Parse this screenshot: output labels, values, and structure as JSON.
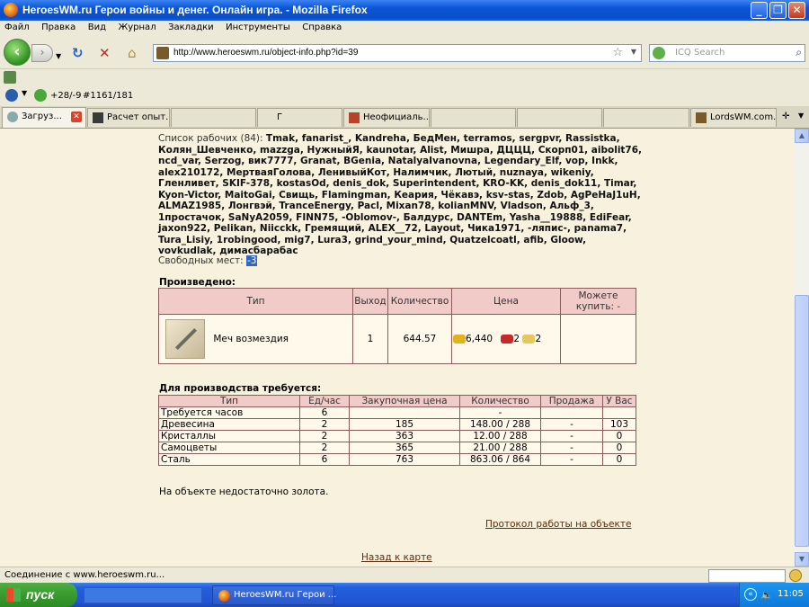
{
  "window": {
    "title": "HeroesWM.ru Герои войны и денег. Онлайн игра. - Mozilla Firefox",
    "minimize": "_",
    "maximize": "❐",
    "close": "✕"
  },
  "menu": [
    "Файл",
    "Правка",
    "Вид",
    "Журнал",
    "Закладки",
    "Инструменты",
    "Справка"
  ],
  "nav": {
    "url": "http://www.heroeswm.ru/object-info.php?id=39",
    "search_placeholder": "ICQ Search"
  },
  "toolbar2": {
    "temp": "+28/-9",
    "counter": "#1161/181"
  },
  "tabs": [
    {
      "label": "Загруз..."
    },
    {
      "label": "Расчет опыт."
    },
    {
      "label": ""
    },
    {
      "label": "Г"
    },
    {
      "label": "Неофициаль..."
    },
    {
      "label": ""
    },
    {
      "label": ""
    },
    {
      "label": "LordsWM.com..."
    }
  ],
  "workers": {
    "label": "Список рабочих (84):",
    "names": "Tmak, fanarist_, Kandreha, БедМен, terramos, sergpvr, Rassistka, Колян_Шевченко, mazzga, НужныйЯ, kaunotar, Alist, Мишра, ДЦЦЦ, Скорп01, aibolit76, ncd_var, Serzog, вик7777, Granat, BGenia, NatalyaIvanovna, Legendary_Elf, vop, Inkk, alex210172, МертваяГолова, ЛенивыйКот, Налимчик, Лютый, nuznaya, wikeniy, Гленливет, SKIF-378, kostasOd, denis_dok, Superintendent, KRO-KK, denis_dok11, Timar, Kyon-Victor, MaitoGai, Свищь, Flamingman, Кеария, Чёкавэ, ksv-stas, Zdob, AgPeHaJ1uH, ALMAZ1985, Лонгвэй, TranceEnergy, Pacl, Mixan78, kolianMNV, Vladson, Альф_3, 1простачок, SaNyA2059, FINN75, -Oblomov-, Балдурс, DANTEm, Yasha__19888, EdiFear, jaxon922, Pelikan, Niicckk, Гремящий, ALEX__72, Layout, Чика1971, -ляпис-, panama7, Tura_Lisiy, 1robingood, mig7, Lura3, grind_your_mind, Quatzelcoatl, afib, Gloow, vovkudlak, димасбарабас",
    "free_label": "Свободных мест:",
    "free_value": "-3"
  },
  "produced": {
    "heading": "Произведено:",
    "headers": [
      "Тип",
      "Выход",
      "Количество",
      "Цена",
      "Можете купить: -"
    ],
    "item": {
      "name": "Меч возмездия",
      "output": "1",
      "quantity": "644.57",
      "price_gold": "6,440",
      "price_res1": "2",
      "price_res2": "2"
    }
  },
  "required": {
    "heading": "Для производства требуется:",
    "headers": [
      "Тип",
      "Ед/час",
      "Закупочная цена",
      "Количество",
      "Продажа",
      "У Вас"
    ],
    "rows": [
      {
        "type": "Требуется часов",
        "rate": "6",
        "price": "",
        "qty": "-",
        "sale": "",
        "have": ""
      },
      {
        "type": "Древесина",
        "rate": "2",
        "price": "185",
        "qty": "148.00 / 288",
        "sale": "-",
        "have": "103"
      },
      {
        "type": "Кристаллы",
        "rate": "2",
        "price": "363",
        "qty": "12.00 / 288",
        "sale": "-",
        "have": "0"
      },
      {
        "type": "Самоцветы",
        "rate": "2",
        "price": "365",
        "qty": "21.00 / 288",
        "sale": "-",
        "have": "0"
      },
      {
        "type": "Сталь",
        "rate": "6",
        "price": "763",
        "qty": "863.06 / 864",
        "sale": "-",
        "have": "0"
      }
    ]
  },
  "note": "На объекте недостаточно золота.",
  "links": {
    "protocol": "Протокол работы на объекте",
    "back": "Назад к карте"
  },
  "status": "Соединение с www.heroeswm.ru...",
  "taskbar": {
    "start": "пуск",
    "item": "HeroesWM.ru Герои ...",
    "clock": "11:05"
  },
  "colors": {
    "table_header": "#f1cbc8",
    "table_border": "#8b5a5a",
    "content_bg": "#f7f1de",
    "link": "#5a2d0c"
  }
}
